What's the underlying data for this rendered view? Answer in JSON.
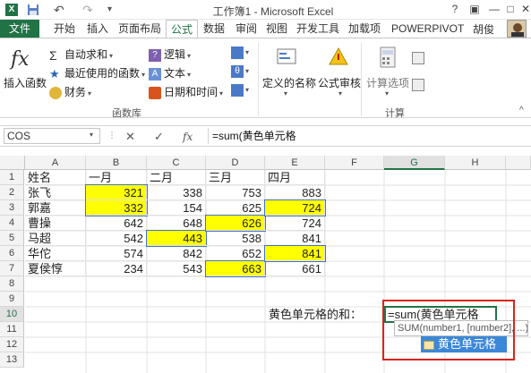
{
  "title": "工作簿1 - Microsoft Excel",
  "tabs": [
    "文件",
    "开始",
    "插入",
    "页面布局",
    "公式",
    "数据",
    "审阅",
    "视图",
    "开发工具",
    "加载项",
    "POWERPIVOT"
  ],
  "user": "胡俊",
  "ribbon": {
    "insert_function": "插入函数",
    "autosum": "自动求和",
    "recent": "最近使用的函数",
    "finance": "财务",
    "logic": "逻辑",
    "text": "文本",
    "datetime": "日期和时间",
    "group_library": "函数库",
    "defined_names": "定义的名称",
    "formula_audit": "公式审核",
    "calc_options": "计算选项",
    "group_calc": "计算"
  },
  "formula_bar": {
    "name_box": "COS",
    "fx_label": "fx",
    "formula": "=sum(黄色单元格"
  },
  "columns": [
    "A",
    "B",
    "C",
    "D",
    "E",
    "F",
    "G",
    "H"
  ],
  "rows": [
    "1",
    "2",
    "3",
    "4",
    "5",
    "6",
    "7",
    "8",
    "9",
    "10",
    "11",
    "12",
    "13"
  ],
  "table": {
    "headers": [
      "姓名",
      "一月",
      "二月",
      "三月",
      "四月"
    ],
    "names": [
      "张飞",
      "郭嘉",
      "曹操",
      "马超",
      "华佗",
      "夏侯惇"
    ],
    "jan": [
      "321",
      "332",
      "642",
      "542",
      "574",
      "234"
    ],
    "feb": [
      "338",
      "154",
      "648",
      "443",
      "842",
      "543"
    ],
    "mar": [
      "753",
      "625",
      "626",
      "538",
      "652",
      "663"
    ],
    "apr": [
      "883",
      "724",
      "724",
      "841",
      "841",
      "661"
    ]
  },
  "label_row10": "黄色单元格的和：",
  "cell_g10": "=sum(黄色单元格",
  "tooltip": "SUM(number1, [number2], ...)",
  "suggestion": "黄色单元格",
  "colors": {
    "excel_green": "#217346",
    "highlight": "#ffff00",
    "callout_red": "#d9241c"
  }
}
